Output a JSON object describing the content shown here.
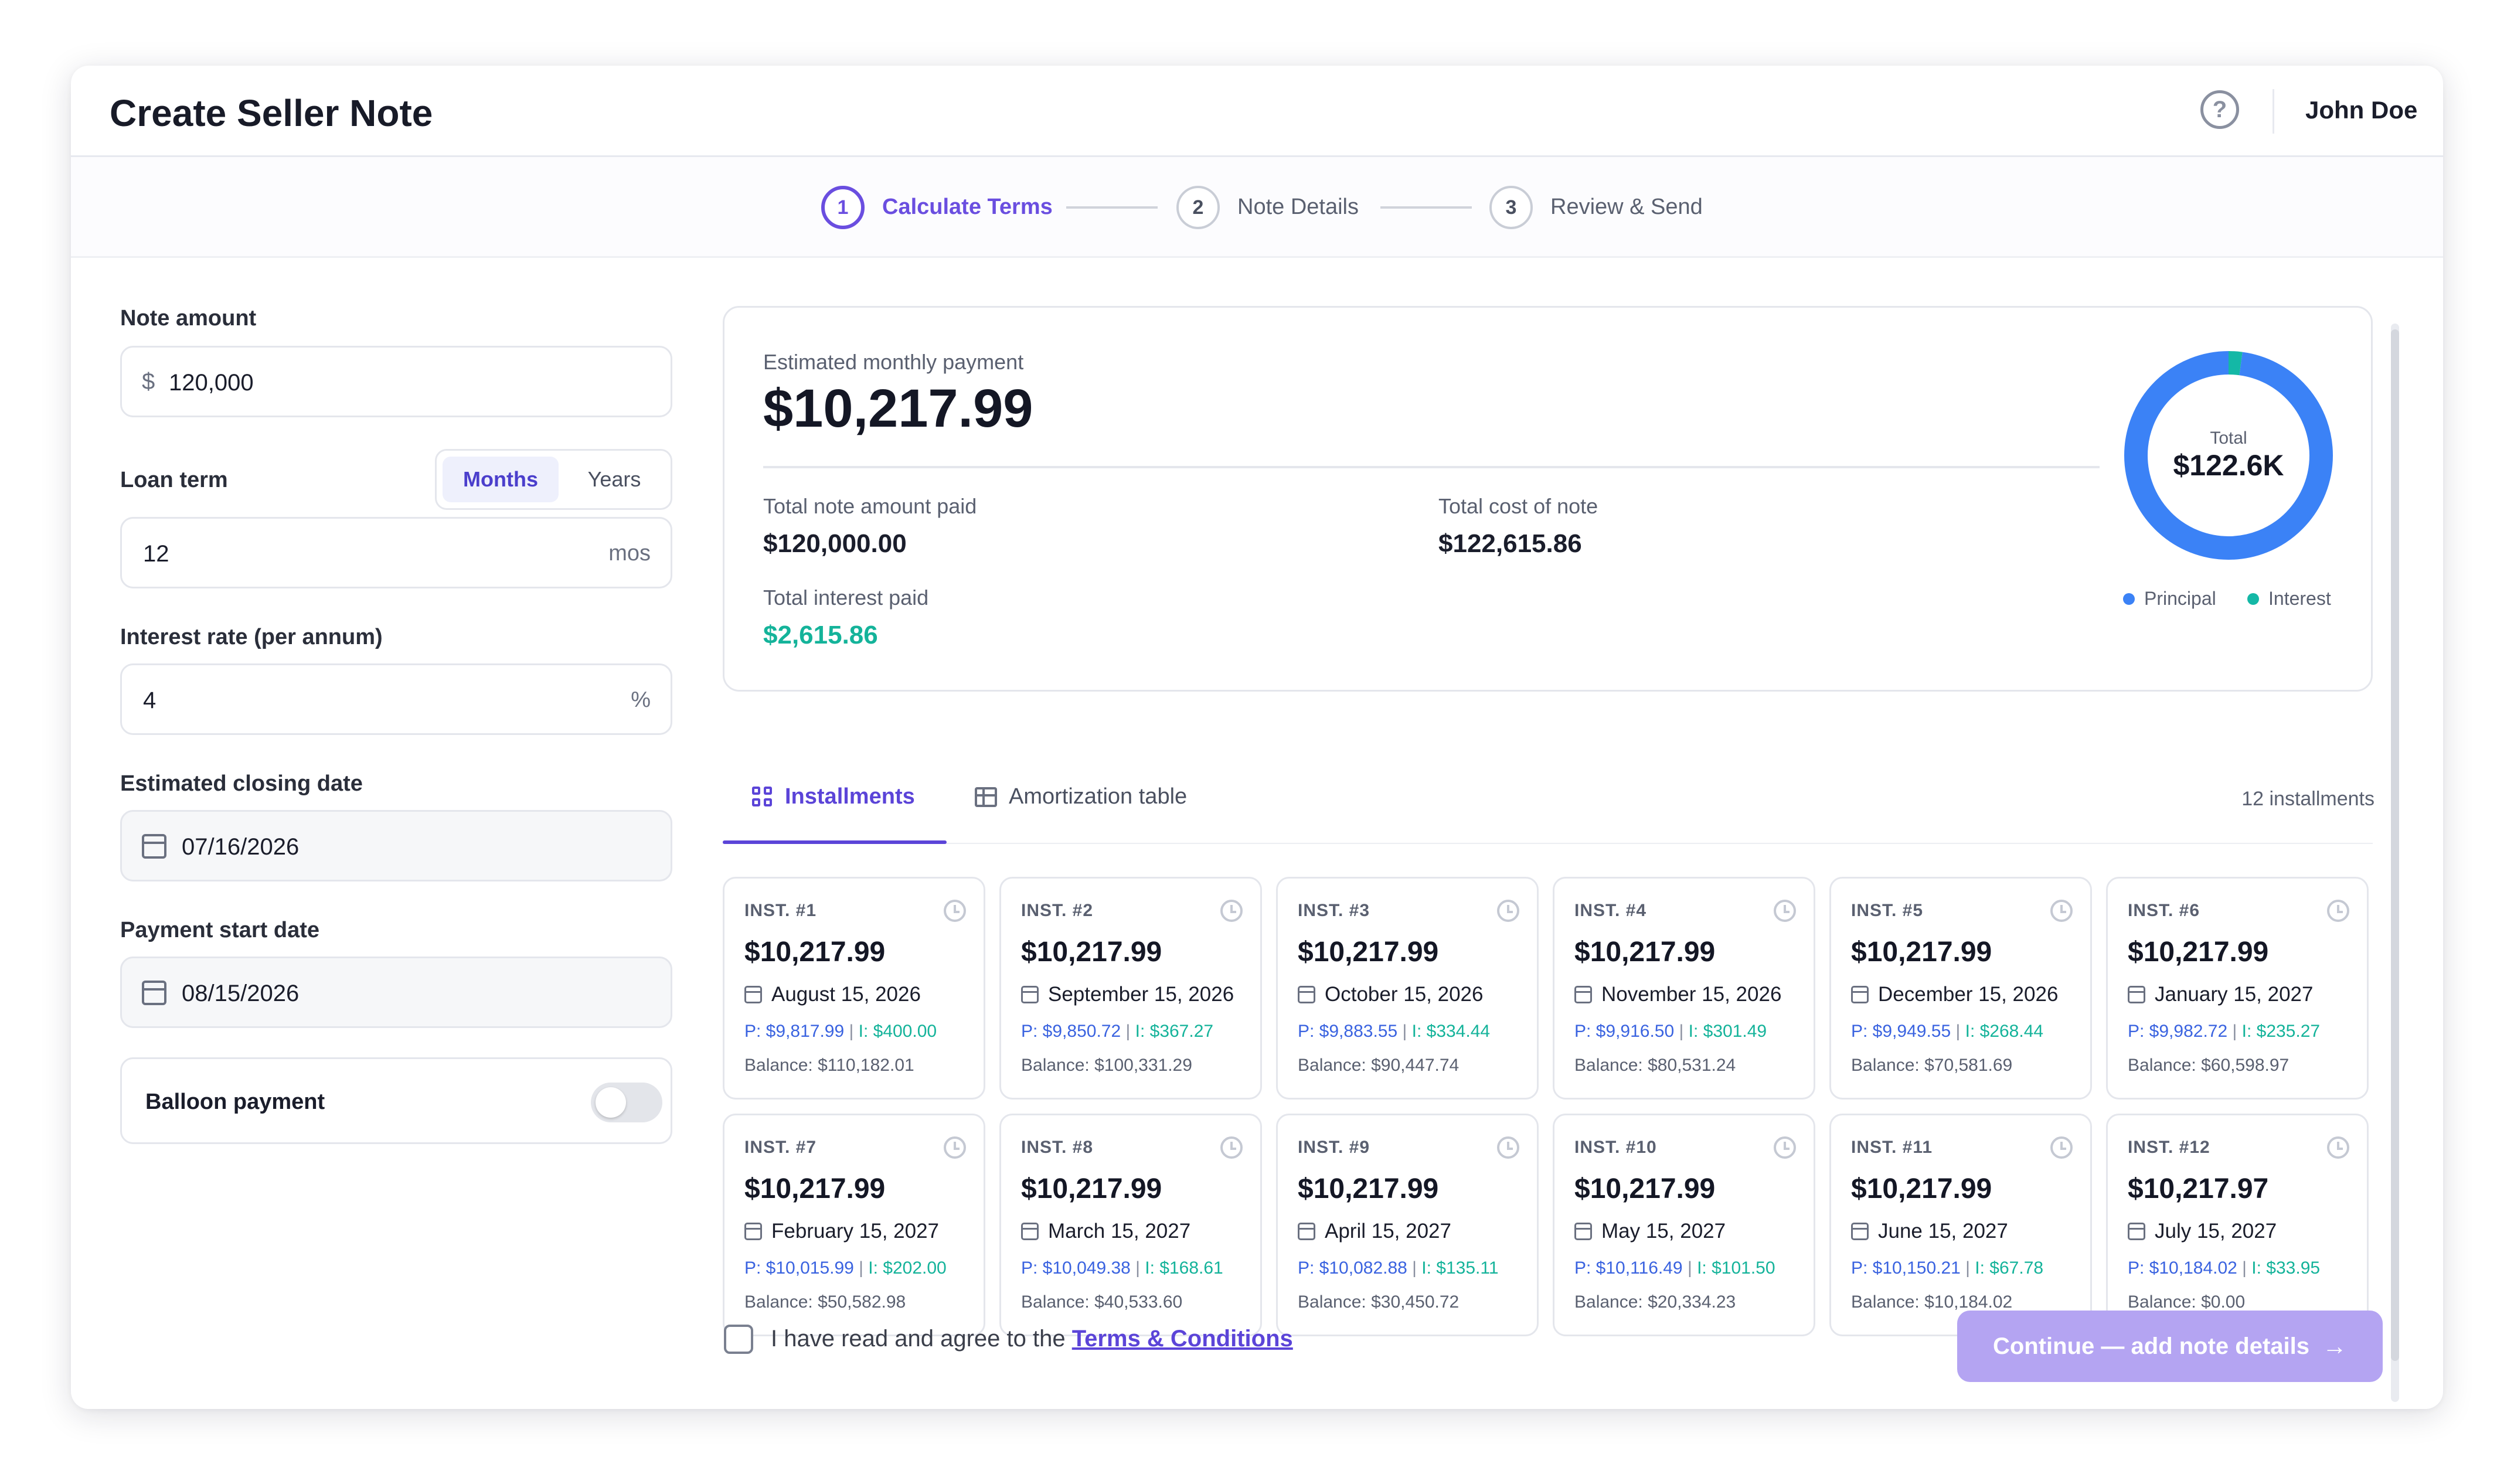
{
  "header": {
    "title": "Create Seller Note",
    "user": "John Doe",
    "help_icon": "help-circle-icon"
  },
  "stepper": {
    "steps": [
      {
        "num": "1",
        "label": "Calculate Terms",
        "active": true
      },
      {
        "num": "2",
        "label": "Note Details",
        "active": false
      },
      {
        "num": "3",
        "label": "Review & Send",
        "active": false
      }
    ]
  },
  "form": {
    "note_amount": {
      "label": "Note amount",
      "prefix": "$",
      "value": "120,000"
    },
    "loan_term": {
      "label": "Loan term",
      "unit_options": [
        "Months",
        "Years"
      ],
      "selected_unit": "Months",
      "value": "12",
      "suffix": "mos"
    },
    "interest_rate": {
      "label": "Interest rate (per annum)",
      "value": "4",
      "suffix": "%"
    },
    "closing_date": {
      "label": "Estimated closing date",
      "value": "07/16/2026"
    },
    "start_date": {
      "label": "Payment start date",
      "value": "08/15/2026"
    },
    "balloon": {
      "label": "Balloon payment",
      "enabled": false
    }
  },
  "summary": {
    "monthly_label": "Estimated monthly payment",
    "monthly_value": "$10,217.99",
    "total_note_label": "Total note amount paid",
    "total_note_value": "$120,000.00",
    "total_cost_label": "Total cost of note",
    "total_cost_value": "$122,615.86",
    "total_interest_label": "Total interest paid",
    "total_interest_value": "$2,615.86",
    "donut": {
      "center_label": "Total",
      "center_value": "$122.6K",
      "principal": 120000.0,
      "interest": 2615.86,
      "principal_color": "#3b82f6",
      "interest_color": "#14b8a6"
    },
    "legend": {
      "principal": "Principal",
      "interest": "Interest"
    }
  },
  "tabs": {
    "installments": "Installments",
    "amortization": "Amortization table",
    "active": "installments",
    "count": "12 installments"
  },
  "installments": [
    {
      "label": "INST. #1",
      "amount": "$10,217.99",
      "date": "August 15, 2026",
      "p": "P: $9,817.99",
      "i": "I: $400.00",
      "balance": "Balance: $110,182.01"
    },
    {
      "label": "INST. #2",
      "amount": "$10,217.99",
      "date": "September 15, 2026",
      "p": "P: $9,850.72",
      "i": "I: $367.27",
      "balance": "Balance: $100,331.29"
    },
    {
      "label": "INST. #3",
      "amount": "$10,217.99",
      "date": "October 15, 2026",
      "p": "P: $9,883.55",
      "i": "I: $334.44",
      "balance": "Balance: $90,447.74"
    },
    {
      "label": "INST. #4",
      "amount": "$10,217.99",
      "date": "November 15, 2026",
      "p": "P: $9,916.50",
      "i": "I: $301.49",
      "balance": "Balance: $80,531.24"
    },
    {
      "label": "INST. #5",
      "amount": "$10,217.99",
      "date": "December 15, 2026",
      "p": "P: $9,949.55",
      "i": "I: $268.44",
      "balance": "Balance: $70,581.69"
    },
    {
      "label": "INST. #6",
      "amount": "$10,217.99",
      "date": "January 15, 2027",
      "p": "P: $9,982.72",
      "i": "I: $235.27",
      "balance": "Balance: $60,598.97"
    },
    {
      "label": "INST. #7",
      "amount": "$10,217.99",
      "date": "February 15, 2027",
      "p": "P: $10,015.99",
      "i": "I: $202.00",
      "balance": "Balance: $50,582.98"
    },
    {
      "label": "INST. #8",
      "amount": "$10,217.99",
      "date": "March 15, 2027",
      "p": "P: $10,049.38",
      "i": "I: $168.61",
      "balance": "Balance: $40,533.60"
    },
    {
      "label": "INST. #9",
      "amount": "$10,217.99",
      "date": "April 15, 2027",
      "p": "P: $10,082.88",
      "i": "I: $135.11",
      "balance": "Balance: $30,450.72"
    },
    {
      "label": "INST. #10",
      "amount": "$10,217.99",
      "date": "May 15, 2027",
      "p": "P: $10,116.49",
      "i": "I: $101.50",
      "balance": "Balance: $20,334.23"
    },
    {
      "label": "INST. #11",
      "amount": "$10,217.99",
      "date": "June 15, 2027",
      "p": "P: $10,150.21",
      "i": "I: $67.78",
      "balance": "Balance: $10,184.02"
    },
    {
      "label": "INST. #12",
      "amount": "$10,217.97",
      "date": "July 15, 2027",
      "p": "P: $10,184.02",
      "i": "I: $33.95",
      "balance": "Balance: $0.00"
    }
  ],
  "footer": {
    "agree_text": "I have read and agree to the ",
    "terms_link": "Terms & Conditions",
    "continue_label": "Continue — add note details",
    "continue_icon": "arrow-right-icon"
  }
}
